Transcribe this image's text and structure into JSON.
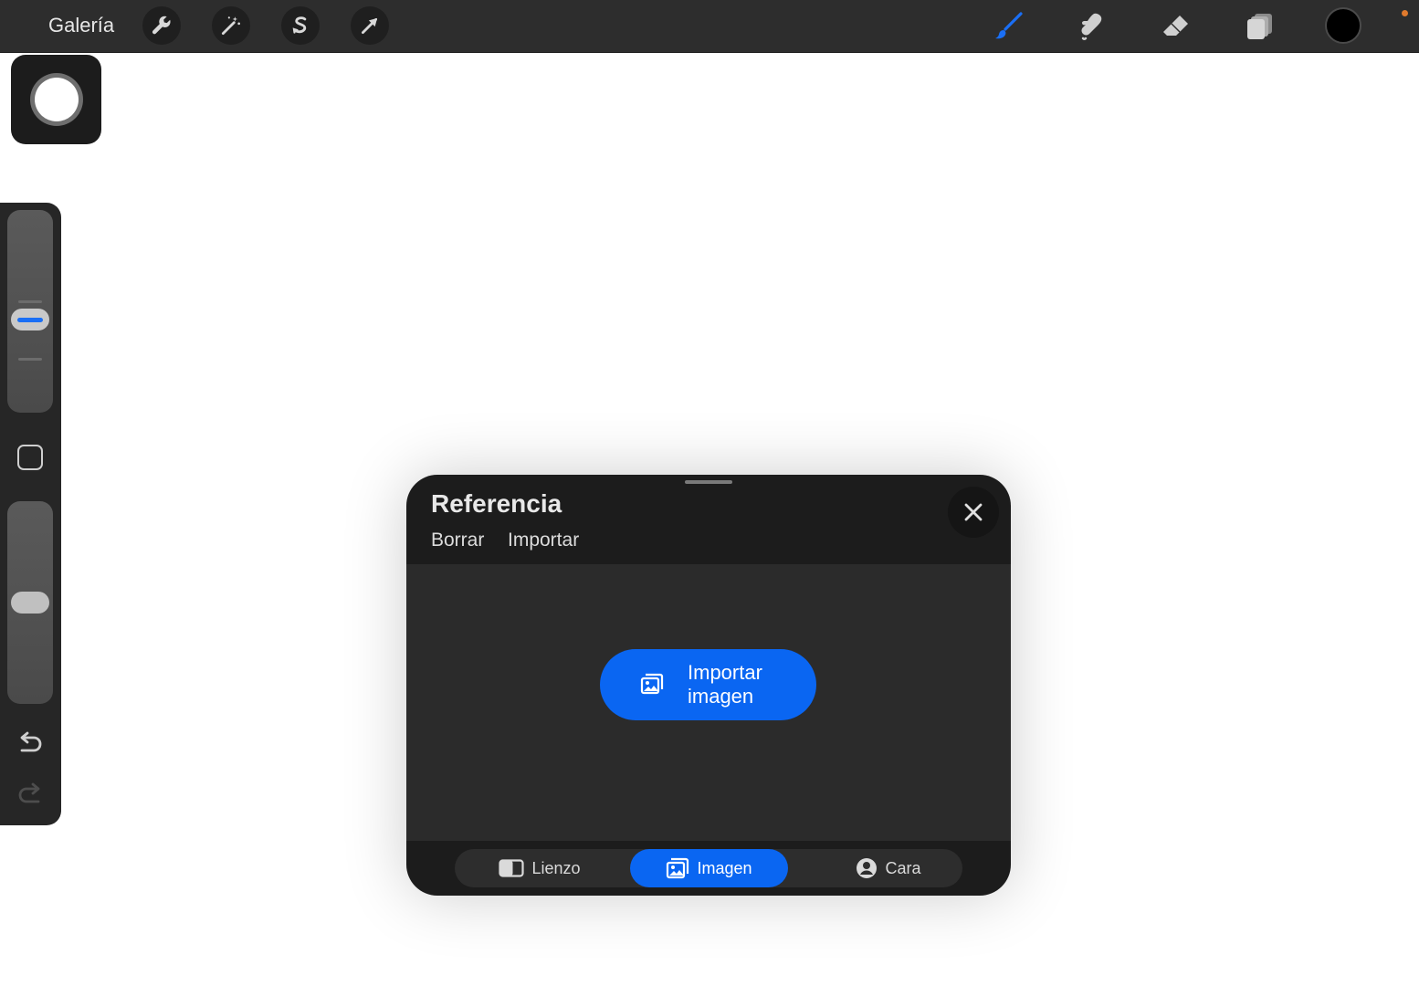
{
  "toolbar": {
    "gallery_label": "Galería",
    "left_tools": [
      {
        "icon": "wrench-icon"
      },
      {
        "icon": "magic-wand-icon"
      },
      {
        "icon": "selection-s-icon"
      },
      {
        "icon": "transform-arrow-icon"
      }
    ],
    "right_tools": [
      {
        "icon": "brush-icon",
        "color": "#1a6ff5"
      },
      {
        "icon": "smudge-icon"
      },
      {
        "icon": "eraser-icon"
      },
      {
        "icon": "layers-icon"
      }
    ],
    "current_color": "#000000"
  },
  "sidebar": {
    "size_slider_value": 0.45,
    "opacity_slider_value": 0.5
  },
  "reference": {
    "title": "Referencia",
    "actions": [
      "Borrar",
      "Importar"
    ],
    "import_button_line1": "Importar",
    "import_button_line2": "imagen",
    "tabs": [
      {
        "label": "Lienzo",
        "active": false
      },
      {
        "label": "Imagen",
        "active": true
      },
      {
        "label": "Cara",
        "active": false
      }
    ]
  },
  "colors": {
    "accent": "#0a66f2",
    "toolbar_bg": "#2d2d2d",
    "panel_bg": "#1c1c1c"
  }
}
